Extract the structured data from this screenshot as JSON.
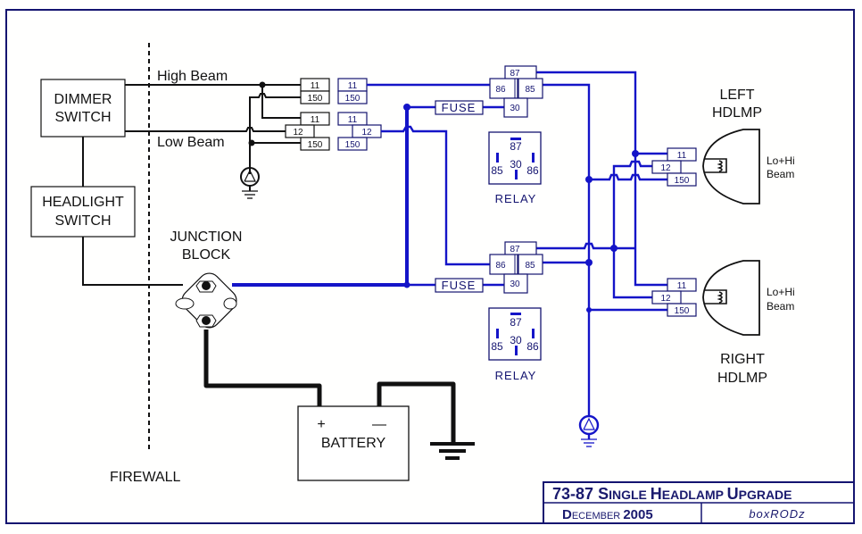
{
  "title_block": {
    "title_num": "73-87",
    "title_words": [
      "S",
      "INGLE ",
      "H",
      "EADLAMP ",
      "U",
      "PGRADE"
    ],
    "date_cap": "D",
    "date_rest": "ECEMBER ",
    "date_year": "2005",
    "author": "boxRODz"
  },
  "components": {
    "dimmer_switch": [
      "DIMMER",
      "SWITCH"
    ],
    "headlight_switch": [
      "HEADLIGHT",
      "SWITCH"
    ],
    "junction_block": [
      "JUNCTION",
      "BLOCK"
    ],
    "battery": {
      "label": "BATTERY",
      "plus": "+",
      "minus": "—"
    },
    "firewall": "FIREWALL",
    "high_beam": "High Beam",
    "low_beam": "Low Beam",
    "left_headlamp": [
      "LEFT",
      "HDLMP"
    ],
    "right_headlamp": [
      "RIGHT",
      "HDLMP"
    ],
    "lamp_desc": [
      "Lo+Hi",
      "Beam"
    ],
    "fuse": "FUSE",
    "relay": "RELAY"
  },
  "connector_pins": {
    "p11": "11",
    "p12": "12",
    "p150": "150"
  },
  "relay_pins": {
    "p87": "87",
    "p86": "86",
    "p85": "85",
    "p30": "30"
  },
  "colors": {
    "wire_power": "#1414c8",
    "wire_stock": "#111111",
    "frame": "#141470"
  }
}
